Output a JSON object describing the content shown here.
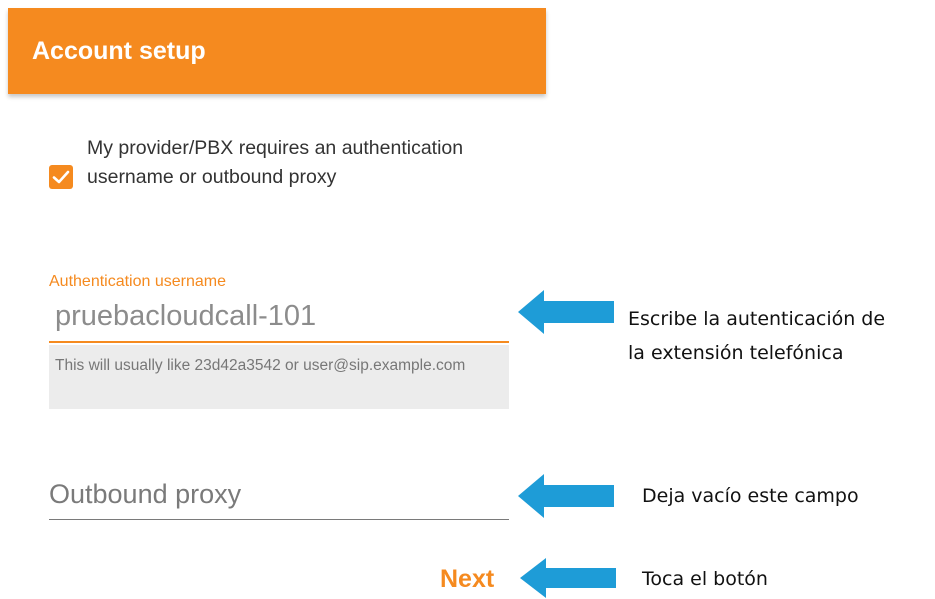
{
  "appbar": {
    "title": "Account setup",
    "color": "#f58a1f"
  },
  "checkbox": {
    "checked": true,
    "label": "My provider/PBX requires an authentication username or outbound proxy"
  },
  "auth_field": {
    "label": "Authentication username",
    "value": "pruebacloudcall-101",
    "hint": "This will usually like 23d42a3542 or user@sip.example.com"
  },
  "proxy_field": {
    "placeholder": "Outbound proxy",
    "value": ""
  },
  "next_button": {
    "label": "Next"
  },
  "annotations": {
    "auth_line1": "Escribe la autenticación de",
    "auth_line2": "la extensión telefónica",
    "proxy": "Deja vacío este campo",
    "next": "Toca el botón",
    "arrow_color": "#1e9cd7",
    "arrow_icon": "arrow-left-icon"
  }
}
